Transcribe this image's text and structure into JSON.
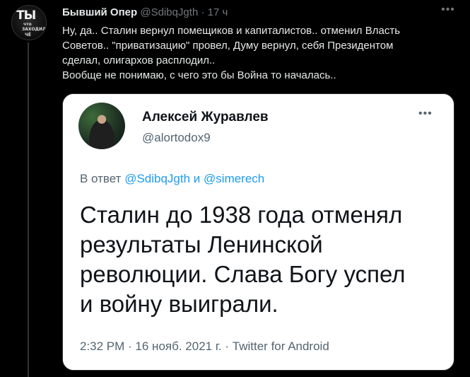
{
  "tweet": {
    "avatar": {
      "big": "ТЫ",
      "line1": "что",
      "line2": "ЗАХОДИЛ",
      "line3": "ЧЁ"
    },
    "display_name": "Бывший Опер",
    "handle": "@SdibqJgth",
    "separator": "·",
    "time": "17 ч",
    "more_icon": "more-horizontal-icon",
    "text_lines": [
      "Ну, да.. Сталин вернул помещиков и капиталистов.. отменил Власть",
      "Советов.. \"приватизацию\" провел, Думу вернул, себя Президентом",
      "сделал, олигархов расплодил..",
      "Вообще не понимаю, с чего это бы Война то началась.."
    ]
  },
  "embedded": {
    "author_name": "Алексей Журавлев",
    "author_handle": "@alortodox9",
    "more_icon": "more-horizontal-icon",
    "reply_prefix": "В ответ",
    "reply_mention_1": "@SdibqJgth",
    "reply_joiner": "и",
    "reply_mention_2": "@simerech",
    "body_lines": [
      "Сталин до 1938 года отменял",
      "результаты Ленинской",
      "революции. Слава Богу успел",
      "и войну выиграли."
    ],
    "meta": "2:32 PM · 16 нояб. 2021 г. · Twitter for Android"
  },
  "colors": {
    "background": "#000000",
    "text": "#e7e9ea",
    "muted": "#71767b",
    "link": "#1d9bf0",
    "card_background": "#ffffff",
    "card_text": "#0f1419",
    "card_muted": "#536471"
  }
}
